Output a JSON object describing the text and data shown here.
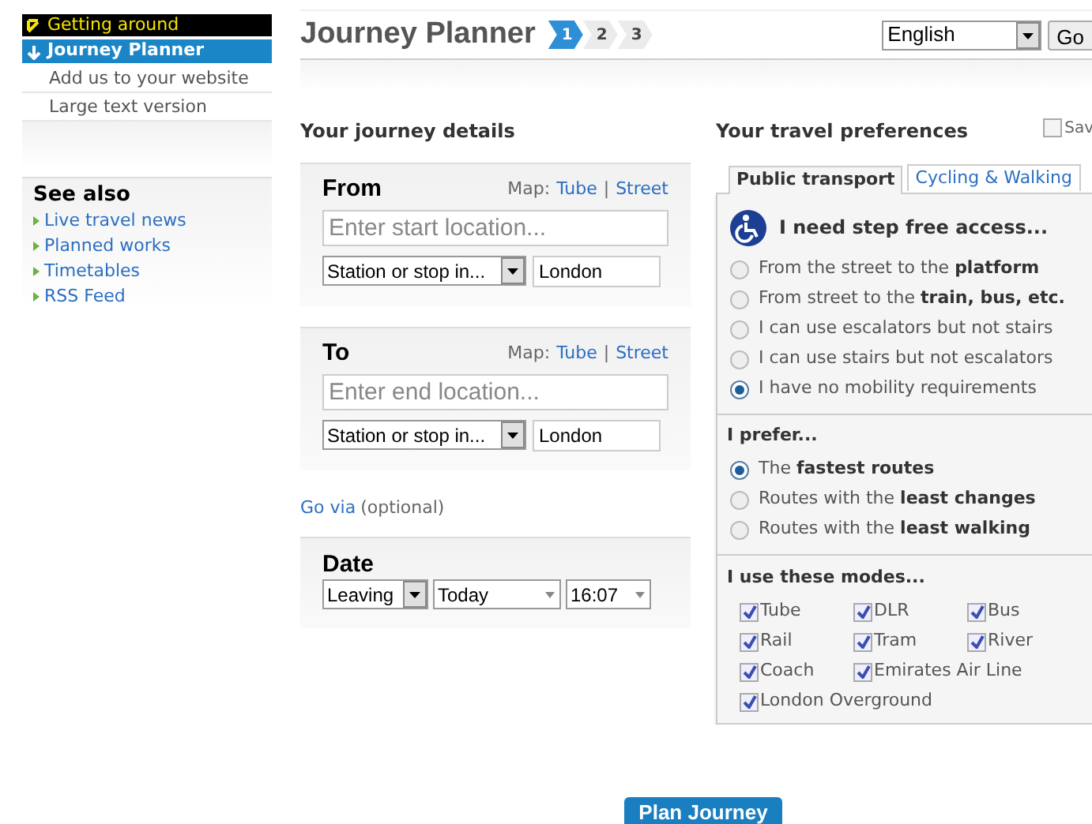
{
  "sidebar": {
    "nav": [
      {
        "label": "Getting around",
        "kind": "section"
      },
      {
        "label": "Journey Planner",
        "kind": "current"
      },
      {
        "label": "Add us to your website",
        "kind": "link"
      },
      {
        "label": "Large text version",
        "kind": "link"
      }
    ],
    "see_also": {
      "title": "See also",
      "links": [
        "Live travel news",
        "Planned works",
        "Timetables",
        "RSS Feed"
      ]
    }
  },
  "header": {
    "title": "Journey Planner",
    "steps": [
      {
        "label": "1",
        "selected": true
      },
      {
        "label": "2",
        "selected": false
      },
      {
        "label": "3",
        "selected": false
      }
    ],
    "language": "English",
    "go_button": "Go"
  },
  "journey_details": {
    "heading": "Your journey details",
    "sections": [
      {
        "title": "From",
        "map_label": "Map:",
        "map_separator": "|",
        "map_links": [
          "Tube",
          "Street"
        ],
        "placeholder": "Enter start location...",
        "type_select": "Station or stop in...",
        "area": "London"
      },
      {
        "title": "To",
        "map_label": "Map:",
        "map_separator": "|",
        "map_links": [
          "Tube",
          "Street"
        ],
        "placeholder": "Enter end location...",
        "type_select": "Station or stop in...",
        "area": "London"
      }
    ],
    "go_via": {
      "link": "Go via",
      "note": "(optional)"
    },
    "date": {
      "title": "Date",
      "leaving": "Leaving",
      "day": "Today",
      "time": "16:07"
    }
  },
  "preferences": {
    "heading": "Your travel preferences",
    "save": {
      "label": "Sav",
      "checked": false
    },
    "tabs": [
      {
        "label": "Public transport",
        "selected": true
      },
      {
        "label": "Cycling & Walking",
        "selected": false
      }
    ],
    "step_free": {
      "title": "I need step free access...",
      "options": [
        {
          "label": "From the street to the **platform**",
          "selected": false
        },
        {
          "label": "From street to the **train, bus, etc.**",
          "selected": false
        },
        {
          "label": "I can use escalators but not stairs",
          "selected": false
        },
        {
          "label": "I can use stairs but not escalators",
          "selected": false
        },
        {
          "label": "I have no mobility requirements",
          "selected": true
        }
      ]
    },
    "prefer": {
      "title": "I prefer...",
      "options": [
        {
          "label": "The **fastest routes**",
          "selected": true
        },
        {
          "label": "Routes with the **least changes**",
          "selected": false
        },
        {
          "label": "Routes with the **least walking**",
          "selected": false
        }
      ]
    },
    "modes": {
      "title": "I use these modes...",
      "items": [
        {
          "label": "Tube",
          "checked": true
        },
        {
          "label": "DLR",
          "checked": true
        },
        {
          "label": "Bus",
          "checked": true
        },
        {
          "label": "Rail",
          "checked": true
        },
        {
          "label": "Tram",
          "checked": true
        },
        {
          "label": "River",
          "checked": true
        },
        {
          "label": "Coach",
          "checked": true
        },
        {
          "label": "Emirates Air Line",
          "checked": true
        },
        {
          "label": "London Overground",
          "checked": true
        }
      ]
    }
  },
  "plan_button": "Plan Journey"
}
